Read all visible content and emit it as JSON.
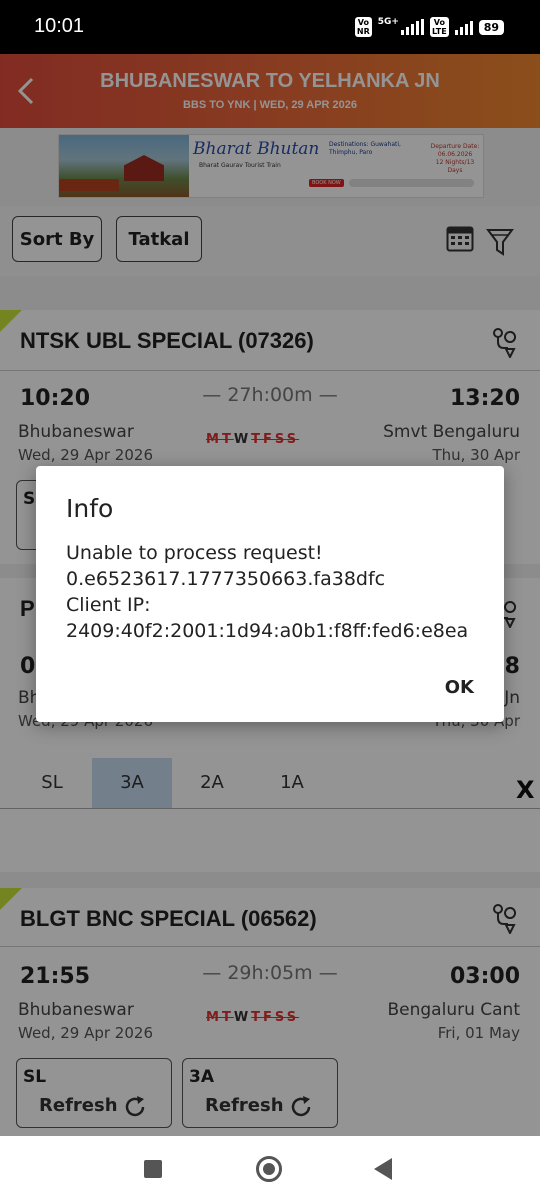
{
  "status_bar": {
    "time": "10:01",
    "network_1": "Vo NR",
    "network_1_tech": "5G+",
    "network_2": "Vo LTE",
    "battery": "89"
  },
  "header": {
    "title": "BHUBANESWAR TO YELHANKA JN",
    "subtitle": "BBS TO YNK | WED, 29 APR  2026",
    "back_icon": "chevron-left-icon"
  },
  "banner": {
    "title": "Bharat Bhutan",
    "subtitle": "Bharat Gaurav Tourist Train",
    "description": "Destinations: Guwahati, Thimphu, Paro",
    "departure": "Departure Date: 06.06.2026",
    "duration": "12 Nights/13 Days",
    "book_label": "BOOK NOW"
  },
  "filters": {
    "sort_label": "Sort By",
    "tatkal_label": "Tatkal",
    "calendar_icon": "calendar-icon",
    "filter_icon": "filter-funnel-icon"
  },
  "trains": [
    {
      "name": "NTSK UBL SPECIAL (07326)",
      "departure_time": "10:20",
      "arrival_time": "13:20",
      "duration": "27h:00m",
      "from_station": "Bhubaneswar",
      "to_station": "Smvt Bengaluru",
      "from_date": "Wed, 29 Apr  2026",
      "to_date": "Thu, 30 Apr",
      "days": [
        "M",
        "T",
        "W",
        "T",
        "F",
        "S",
        "S"
      ],
      "class_1": "S"
    },
    {
      "name": "P",
      "departure_time": "05",
      "arrival_time": "58",
      "from_station": "Bh",
      "to_station": "Jn",
      "from_date": "Wed, 29 Apr  2026",
      "to_date": "Thu, 30 Apr"
    },
    {
      "name": "BLGT BNC SPECIAL (06562)",
      "departure_time": "21:55",
      "arrival_time": "03:00",
      "duration": "29h:05m",
      "from_station": "Bhubaneswar",
      "to_station": "Bengaluru Cant",
      "from_date": "Wed, 29 Apr  2026",
      "to_date": "Fri, 01 May",
      "days": [
        "M",
        "T",
        "W",
        "T",
        "F",
        "S",
        "S"
      ],
      "classes": [
        {
          "code": "SL",
          "action": "Refresh"
        },
        {
          "code": "3A",
          "action": "Refresh"
        }
      ]
    }
  ],
  "class_tabs": [
    "SL",
    "3A",
    "2A",
    "1A"
  ],
  "selected_tab": "3A",
  "close_label": "X",
  "dialog": {
    "title": "Info",
    "message_line_1": "Unable to process request!",
    "message_line_2": "0.e6523617.1777350663.fa38dfc",
    "message_line_3": "Client IP:",
    "message_line_4": "2409:40f2:2001:1d94:a0b1:f8ff:fed6:e8ea",
    "ok_label": "OK"
  }
}
